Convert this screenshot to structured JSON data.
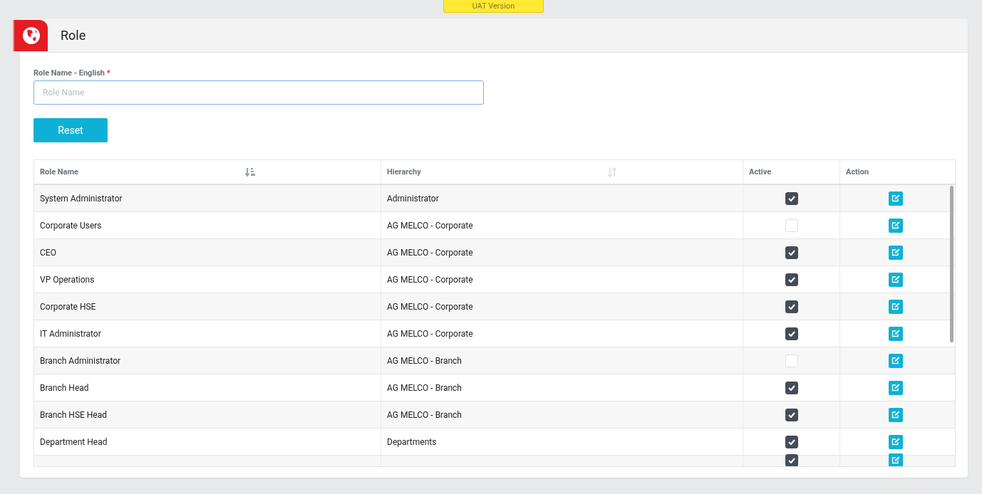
{
  "banner": "UAT Version",
  "page": {
    "title": "Role"
  },
  "form": {
    "label": "Role Name - English",
    "required_mark": "*",
    "placeholder": "Role Name",
    "button": "Reset"
  },
  "table": {
    "columns": [
      {
        "label": "Role Name",
        "kind": "sort",
        "sorted": true
      },
      {
        "label": "Hierarchy",
        "kind": "sort",
        "sorted": false
      },
      {
        "label": "Active",
        "kind": "center"
      },
      {
        "label": "Action",
        "kind": "center"
      }
    ],
    "rows": [
      {
        "role": "System Administrator",
        "hierarchy": "Administrator",
        "active": true
      },
      {
        "role": "Corporate Users",
        "hierarchy": "AG MELCO - Corporate",
        "active": false
      },
      {
        "role": "CEO",
        "hierarchy": "AG MELCO - Corporate",
        "active": true
      },
      {
        "role": "VP Operations",
        "hierarchy": "AG MELCO - Corporate",
        "active": true
      },
      {
        "role": "Corporate HSE",
        "hierarchy": "AG MELCO - Corporate",
        "active": true
      },
      {
        "role": "IT Administrator",
        "hierarchy": "AG MELCO - Corporate",
        "active": true
      },
      {
        "role": "Branch Administrator",
        "hierarchy": "AG MELCO - Branch",
        "active": false
      },
      {
        "role": "Branch Head",
        "hierarchy": "AG MELCO - Branch",
        "active": true
      },
      {
        "role": "Branch HSE Head",
        "hierarchy": "AG MELCO - Branch",
        "active": true
      },
      {
        "role": "Department Head",
        "hierarchy": "Departments",
        "active": true
      },
      {
        "active": true
      }
    ]
  }
}
